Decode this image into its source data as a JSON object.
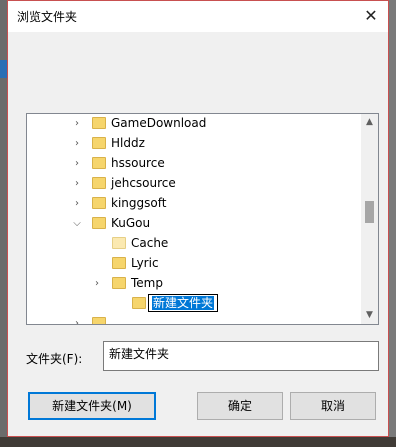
{
  "window": {
    "title": "浏览文件夹",
    "close_glyph": "✕"
  },
  "tree": {
    "items": [
      {
        "label": "GameDownload",
        "level": 0,
        "expander": "collapsed"
      },
      {
        "label": "Hlddz",
        "level": 0,
        "expander": "collapsed"
      },
      {
        "label": "hssource",
        "level": 0,
        "expander": "collapsed"
      },
      {
        "label": "jehcsource",
        "level": 0,
        "expander": "collapsed"
      },
      {
        "label": "kinggsoft",
        "level": 0,
        "expander": "collapsed"
      },
      {
        "label": "KuGou",
        "level": 0,
        "expander": "expanded"
      },
      {
        "label": "Cache",
        "level": 1,
        "expander": "none"
      },
      {
        "label": "Lyric",
        "level": 1,
        "expander": "none"
      },
      {
        "label": "Temp",
        "level": 1,
        "expander": "collapsed"
      },
      {
        "label": "新建文件夹",
        "level": 2,
        "expander": "none",
        "editing": true
      }
    ],
    "scroll_up_glyph": "▲",
    "scroll_down_glyph": "▼"
  },
  "folder_field": {
    "label": "文件夹(F):",
    "value": "新建文件夹"
  },
  "buttons": {
    "new_folder": "新建文件夹(M)",
    "ok": "确定",
    "cancel": "取消"
  },
  "colors": {
    "title_border": "#c85050",
    "selection": "#0078d7",
    "folder_yellow": "#f6d56c"
  }
}
